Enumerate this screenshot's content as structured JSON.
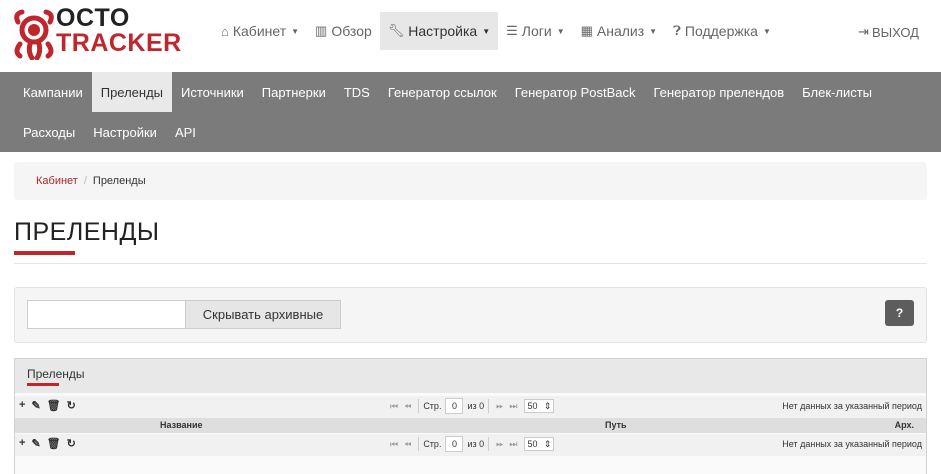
{
  "brand": {
    "line1": "OCTO",
    "line2": "TRACKER"
  },
  "top_nav": [
    {
      "label": "Кабинет",
      "icon": "home-icon",
      "caret": true
    },
    {
      "label": "Обзор",
      "icon": "bar-chart-icon",
      "caret": false
    },
    {
      "label": "Настройка",
      "icon": "wrench-icon",
      "caret": true,
      "active": true
    },
    {
      "label": "Логи",
      "icon": "list-icon",
      "caret": true
    },
    {
      "label": "Анализ",
      "icon": "table-icon",
      "caret": true
    },
    {
      "label": "Поддержка",
      "icon": "question-circle-icon",
      "caret": true
    }
  ],
  "logout": {
    "label": "ВЫХОД",
    "icon": "sign-out-icon"
  },
  "sub_nav": {
    "row1": [
      "Кампании",
      "Преленды",
      "Источники",
      "Партнерки",
      "TDS",
      "Генератор ссылок",
      "Генератор PostBack",
      "Генератор прелендов",
      "Блек-листы"
    ],
    "row2": [
      "Расходы",
      "Настройки",
      "API"
    ],
    "active": "Преленды"
  },
  "breadcrumb": {
    "home": "Кабинет",
    "current": "Преленды"
  },
  "page_title": "ПРЕЛЕНДЫ",
  "filter": {
    "input_value": "",
    "hide_archived": "Скрывать архивные",
    "help_label": "?"
  },
  "grid": {
    "caption": "Преленды",
    "columns": [
      "Название",
      "Путь",
      "Арх."
    ],
    "pager": {
      "page_label": "Стр.",
      "page_value": "0",
      "of_label": "из 0",
      "rows_per_page": "50"
    },
    "empty_text": "Нет данных за указанный период"
  },
  "colors": {
    "accent": "#c0272d",
    "subnav_bg": "#7b7b7b"
  }
}
